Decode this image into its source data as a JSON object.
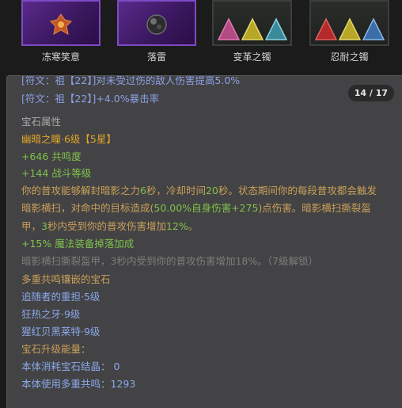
{
  "slots": [
    {
      "name": "冻寒笑意",
      "icon": "frost-grin-gem-icon"
    },
    {
      "name": "落雷",
      "icon": "thunder-orb-gem-icon"
    },
    {
      "name": "变革之镯",
      "icon": "triangles-bracelet-icon"
    },
    {
      "name": "忍耐之镯",
      "icon": "triangles-bracelet-icon"
    }
  ],
  "tooltip": {
    "page": "14 / 17",
    "rune_lines": [
      "[符文：祖【22】]对未受过伤的敌人伤害提高5.0%",
      "[符文：祖【22】]+4.0%暴击率"
    ],
    "gem_section_title": "宝石属性",
    "gem_name": "幽暗之瞳·6级【5星】",
    "resonance": "+646 共鸣度",
    "battle_level": "+144 战斗等级",
    "desc": {
      "p1": "你的普攻能够解封暗影之力",
      "v1": "6",
      "p2": "秒，冷却时间",
      "v2": "20",
      "p3": "秒。状态期间你的每段普攻都会触发",
      "l2p1": "暗影横扫，对命中的目标造成(",
      "l2v1": "50.00%",
      "l2p2": "自身伤害",
      "l2v2": "+275",
      "l2p3": ")点伤害。暗影横扫撕裂盔",
      "l3p1": "甲，",
      "l3v1": "3",
      "l3p2": "秒内受到你的普攻伤害增加",
      "l3v2": "12%",
      "l3p3": "。"
    },
    "magic_drop": "+15% 魔法装备掉落加成",
    "locked_line": "暗影横扫撕裂盔甲，3秒内受到你的普攻伤害增加18%。（7级解锁）",
    "multi_title": "多重共鸣镶嵌的宝石",
    "multi_gems": [
      "追随者的重担·5级",
      "狂热之牙·9级",
      "猩红贝黑莱特·9级"
    ],
    "upgrade_title": "宝石升级能量：",
    "crystal_label": "本体消耗宝石结晶：",
    "crystal_value": "0",
    "multi_use_label": "本体使用多重共鸣：",
    "multi_use_value": "1293"
  }
}
